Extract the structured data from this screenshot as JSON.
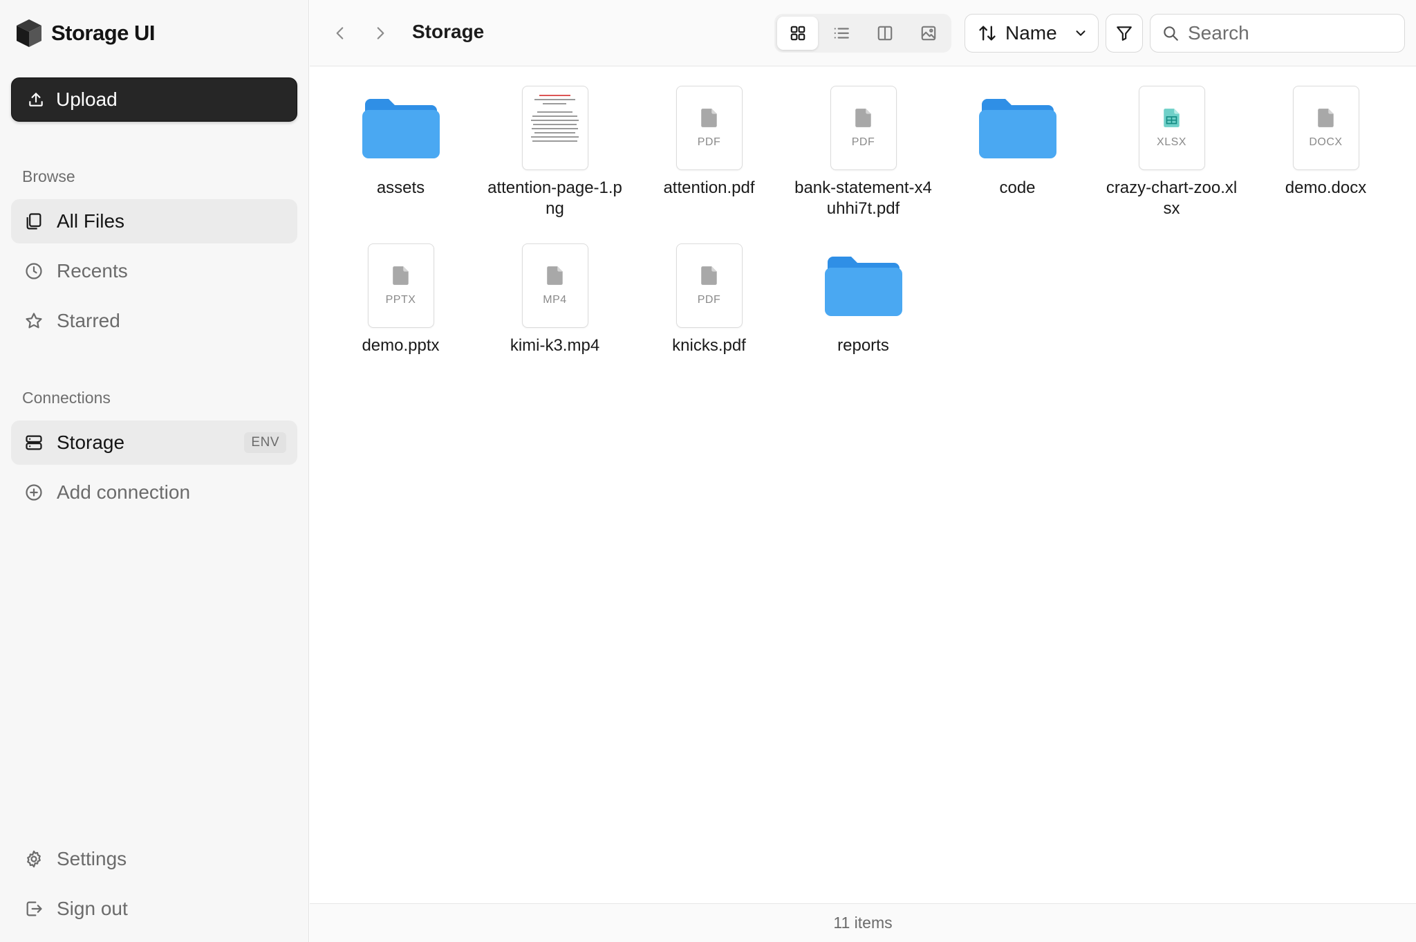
{
  "app": {
    "name": "Storage UI"
  },
  "sidebar": {
    "upload_label": "Upload",
    "browse_label": "Browse",
    "browse_items": [
      {
        "label": "All Files",
        "icon": "files-icon",
        "active": true
      },
      {
        "label": "Recents",
        "icon": "clock-icon",
        "active": false
      },
      {
        "label": "Starred",
        "icon": "star-icon",
        "active": false
      }
    ],
    "connections_label": "Connections",
    "connections": [
      {
        "label": "Storage",
        "badge": "ENV",
        "icon": "server-icon",
        "active": true
      },
      {
        "label": "Add connection",
        "icon": "plus-circle-icon",
        "active": false
      }
    ],
    "footer_items": [
      {
        "label": "Settings",
        "icon": "gear-icon"
      },
      {
        "label": "Sign out",
        "icon": "sign-out-icon"
      }
    ]
  },
  "toolbar": {
    "breadcrumb": "Storage",
    "view_modes": [
      "grid",
      "list",
      "columns",
      "gallery"
    ],
    "active_view": "grid",
    "sort_label": "Name",
    "search_placeholder": "Search"
  },
  "files": [
    {
      "name": "assets",
      "type": "folder"
    },
    {
      "name": "attention-page-1.png",
      "type": "image"
    },
    {
      "name": "attention.pdf",
      "type": "file",
      "ext": "PDF"
    },
    {
      "name": "bank-statement-x4uhhi7t.pdf",
      "type": "file",
      "ext": "PDF"
    },
    {
      "name": "code",
      "type": "folder"
    },
    {
      "name": "crazy-chart-zoo.xlsx",
      "type": "file",
      "ext": "XLSX"
    },
    {
      "name": "demo.docx",
      "type": "file",
      "ext": "DOCX"
    },
    {
      "name": "demo.pptx",
      "type": "file",
      "ext": "PPTX"
    },
    {
      "name": "kimi-k3.mp4",
      "type": "file",
      "ext": "MP4"
    },
    {
      "name": "knicks.pdf",
      "type": "file",
      "ext": "PDF"
    },
    {
      "name": "reports",
      "type": "folder"
    }
  ],
  "status": {
    "item_count": "11 items"
  },
  "colors": {
    "accent": "#262626",
    "folder": "#3d9ef0",
    "sheet": "#20a8a0"
  }
}
